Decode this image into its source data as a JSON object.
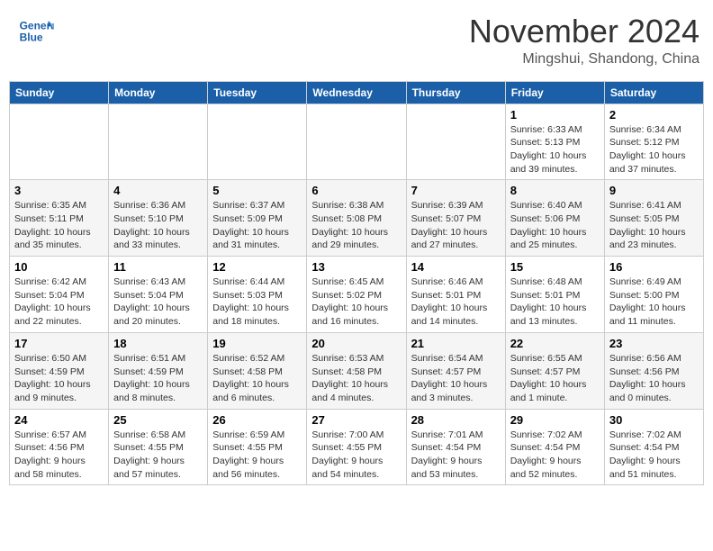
{
  "header": {
    "logo_line1": "General",
    "logo_line2": "Blue",
    "month": "November 2024",
    "location": "Mingshui, Shandong, China"
  },
  "weekdays": [
    "Sunday",
    "Monday",
    "Tuesday",
    "Wednesday",
    "Thursday",
    "Friday",
    "Saturday"
  ],
  "weeks": [
    [
      {
        "day": "",
        "info": ""
      },
      {
        "day": "",
        "info": ""
      },
      {
        "day": "",
        "info": ""
      },
      {
        "day": "",
        "info": ""
      },
      {
        "day": "",
        "info": ""
      },
      {
        "day": "1",
        "info": "Sunrise: 6:33 AM\nSunset: 5:13 PM\nDaylight: 10 hours\nand 39 minutes."
      },
      {
        "day": "2",
        "info": "Sunrise: 6:34 AM\nSunset: 5:12 PM\nDaylight: 10 hours\nand 37 minutes."
      }
    ],
    [
      {
        "day": "3",
        "info": "Sunrise: 6:35 AM\nSunset: 5:11 PM\nDaylight: 10 hours\nand 35 minutes."
      },
      {
        "day": "4",
        "info": "Sunrise: 6:36 AM\nSunset: 5:10 PM\nDaylight: 10 hours\nand 33 minutes."
      },
      {
        "day": "5",
        "info": "Sunrise: 6:37 AM\nSunset: 5:09 PM\nDaylight: 10 hours\nand 31 minutes."
      },
      {
        "day": "6",
        "info": "Sunrise: 6:38 AM\nSunset: 5:08 PM\nDaylight: 10 hours\nand 29 minutes."
      },
      {
        "day": "7",
        "info": "Sunrise: 6:39 AM\nSunset: 5:07 PM\nDaylight: 10 hours\nand 27 minutes."
      },
      {
        "day": "8",
        "info": "Sunrise: 6:40 AM\nSunset: 5:06 PM\nDaylight: 10 hours\nand 25 minutes."
      },
      {
        "day": "9",
        "info": "Sunrise: 6:41 AM\nSunset: 5:05 PM\nDaylight: 10 hours\nand 23 minutes."
      }
    ],
    [
      {
        "day": "10",
        "info": "Sunrise: 6:42 AM\nSunset: 5:04 PM\nDaylight: 10 hours\nand 22 minutes."
      },
      {
        "day": "11",
        "info": "Sunrise: 6:43 AM\nSunset: 5:04 PM\nDaylight: 10 hours\nand 20 minutes."
      },
      {
        "day": "12",
        "info": "Sunrise: 6:44 AM\nSunset: 5:03 PM\nDaylight: 10 hours\nand 18 minutes."
      },
      {
        "day": "13",
        "info": "Sunrise: 6:45 AM\nSunset: 5:02 PM\nDaylight: 10 hours\nand 16 minutes."
      },
      {
        "day": "14",
        "info": "Sunrise: 6:46 AM\nSunset: 5:01 PM\nDaylight: 10 hours\nand 14 minutes."
      },
      {
        "day": "15",
        "info": "Sunrise: 6:48 AM\nSunset: 5:01 PM\nDaylight: 10 hours\nand 13 minutes."
      },
      {
        "day": "16",
        "info": "Sunrise: 6:49 AM\nSunset: 5:00 PM\nDaylight: 10 hours\nand 11 minutes."
      }
    ],
    [
      {
        "day": "17",
        "info": "Sunrise: 6:50 AM\nSunset: 4:59 PM\nDaylight: 10 hours\nand 9 minutes."
      },
      {
        "day": "18",
        "info": "Sunrise: 6:51 AM\nSunset: 4:59 PM\nDaylight: 10 hours\nand 8 minutes."
      },
      {
        "day": "19",
        "info": "Sunrise: 6:52 AM\nSunset: 4:58 PM\nDaylight: 10 hours\nand 6 minutes."
      },
      {
        "day": "20",
        "info": "Sunrise: 6:53 AM\nSunset: 4:58 PM\nDaylight: 10 hours\nand 4 minutes."
      },
      {
        "day": "21",
        "info": "Sunrise: 6:54 AM\nSunset: 4:57 PM\nDaylight: 10 hours\nand 3 minutes."
      },
      {
        "day": "22",
        "info": "Sunrise: 6:55 AM\nSunset: 4:57 PM\nDaylight: 10 hours\nand 1 minute."
      },
      {
        "day": "23",
        "info": "Sunrise: 6:56 AM\nSunset: 4:56 PM\nDaylight: 10 hours\nand 0 minutes."
      }
    ],
    [
      {
        "day": "24",
        "info": "Sunrise: 6:57 AM\nSunset: 4:56 PM\nDaylight: 9 hours\nand 58 minutes."
      },
      {
        "day": "25",
        "info": "Sunrise: 6:58 AM\nSunset: 4:55 PM\nDaylight: 9 hours\nand 57 minutes."
      },
      {
        "day": "26",
        "info": "Sunrise: 6:59 AM\nSunset: 4:55 PM\nDaylight: 9 hours\nand 56 minutes."
      },
      {
        "day": "27",
        "info": "Sunrise: 7:00 AM\nSunset: 4:55 PM\nDaylight: 9 hours\nand 54 minutes."
      },
      {
        "day": "28",
        "info": "Sunrise: 7:01 AM\nSunset: 4:54 PM\nDaylight: 9 hours\nand 53 minutes."
      },
      {
        "day": "29",
        "info": "Sunrise: 7:02 AM\nSunset: 4:54 PM\nDaylight: 9 hours\nand 52 minutes."
      },
      {
        "day": "30",
        "info": "Sunrise: 7:02 AM\nSunset: 4:54 PM\nDaylight: 9 hours\nand 51 minutes."
      }
    ]
  ]
}
